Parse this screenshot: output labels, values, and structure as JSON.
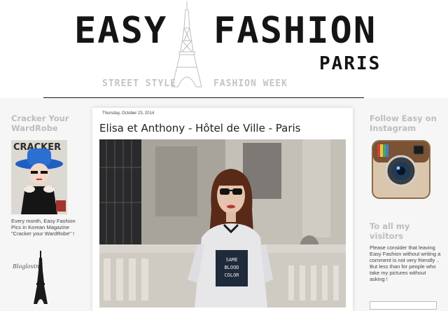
{
  "header": {
    "brand_easy": "EASY",
    "brand_fashion": "FASHION",
    "brand_city": "PARIS",
    "tagline_left": "STREET STYLE",
    "tagline_right": "FASHION WEEK"
  },
  "left_sidebar": {
    "title": "Cracker Your WardRobe",
    "magazine_cover_text": "CRACKER",
    "caption": "Every month, Easy Fashion Pics in Korean Magazine \"Cracker your WardRobe\" !",
    "bloglovin_label": "Bloglovin'"
  },
  "post": {
    "date": "Thursday, October 23, 2014",
    "title": "Elisa et Anthony - Hôtel de Ville - Paris",
    "shirt_text_line1": "SAME",
    "shirt_text_line2": "BLOOD",
    "shirt_text_line3": "COLOR"
  },
  "right_sidebar": {
    "instagram_title": "Follow Easy on Instagram",
    "visitors_title": "To all my visitors",
    "visitors_text": "Please consider that leaving Easy Fashion without writing a comment is not very friendly .. But less than for people who take my pictures without asking !"
  },
  "colors": {
    "page_background": "#f6f6f6",
    "sidebar_heading": "#bdbdbd",
    "brand_text": "#141414"
  }
}
